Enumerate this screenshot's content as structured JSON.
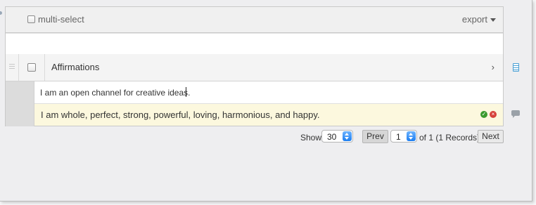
{
  "toolbar": {
    "multi_select_label": "multi-select",
    "export_label": "export"
  },
  "list_header": {
    "title": "Affirmations",
    "chevron": "›"
  },
  "new_item": {
    "value": "I am an open channel for creative ideas."
  },
  "items": [
    {
      "text": "I am whole, perfect, strong, powerful, loving, harmonious, and happy."
    }
  ],
  "pager": {
    "show_label": "Show",
    "page_size": "30",
    "prev_label": "Prev",
    "page": "1",
    "of_text": "of 1 (1 Records)",
    "next_label": "Next"
  },
  "icons": {
    "ok": "check-circle-icon",
    "delete": "remove-circle-icon",
    "doc": "document-icon",
    "comment": "comment-icon"
  },
  "colors": {
    "item_highlight": "#fcf8de",
    "ok_green": "#3a9a2e",
    "delete_red": "#d6413a",
    "select_blue": "#1d7ef0"
  }
}
